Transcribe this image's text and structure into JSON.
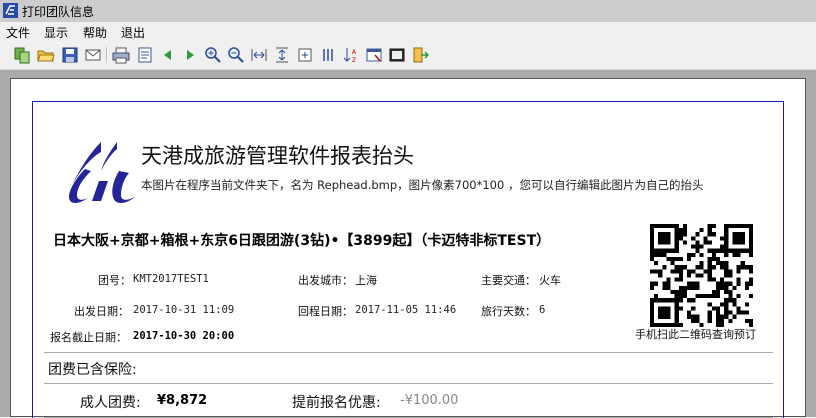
{
  "window": {
    "title": "打印团队信息",
    "app_icon": "report-app-icon"
  },
  "menu": [
    "文件",
    "显示",
    "帮助",
    "退出"
  ],
  "toolbar": [
    "export-icon",
    "open-icon",
    "save-icon",
    "email-icon",
    "print-icon",
    "page-setup-icon",
    "prev-page-icon",
    "next-page-icon",
    "zoom-in-icon",
    "zoom-out-icon",
    "fit-width-icon",
    "fit-height-icon",
    "fit-page-icon",
    "column-icon",
    "sort-icon",
    "window-icon",
    "snapshot-icon",
    "exit-icon"
  ],
  "report": {
    "header_title": "天港成旅游管理软件报表抬头",
    "header_sub": "本图片在程序当前文件夹下，名为 Rephead.bmp，图片像素700*100 ，您可以自行编辑此图片为自己的抬头",
    "tour_title": "日本大阪+京都+箱根+东京6日跟团游(3钻)•【3899起】（卡迈特非标TEST）",
    "fields": {
      "group_no_label": "团号：",
      "group_no": "KMT2017TEST1",
      "depart_city_label": "出发城市：",
      "depart_city": "上海",
      "transport_label": "主要交通：",
      "transport": "火车",
      "depart_date_label": "出发日期：",
      "depart_date": "2017-10-31 11:09",
      "return_date_label": "回程日期：",
      "return_date": "2017-11-05 11:46",
      "days_label": "旅行天数：",
      "days": "6",
      "deadline_label": "报名截止日期：",
      "deadline": "2017-10-30 20:00"
    },
    "qr_caption": "手机扫此二维码查询预订",
    "insurance_text": "团费已含保险:",
    "adult_fee_label": "成人团费:",
    "adult_fee": "¥8,872",
    "early_discount_label": "提前报名优惠:",
    "early_discount": "-¥100.00"
  }
}
